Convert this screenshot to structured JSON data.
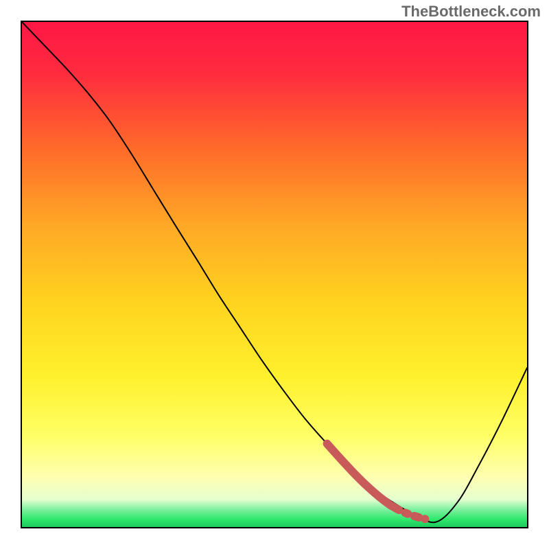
{
  "watermark": "TheBottleneck.com",
  "chart_data": {
    "type": "line",
    "title": "",
    "xlabel": "",
    "ylabel": "",
    "xlim": [
      0,
      100
    ],
    "ylim": [
      0,
      100
    ],
    "grid": false,
    "legend": false,
    "gradient_stops": [
      {
        "offset": 0.0,
        "color": "#ff1744"
      },
      {
        "offset": 0.1,
        "color": "#ff2b3f"
      },
      {
        "offset": 0.25,
        "color": "#ff6a2a"
      },
      {
        "offset": 0.4,
        "color": "#ffa726"
      },
      {
        "offset": 0.55,
        "color": "#ffd21f"
      },
      {
        "offset": 0.7,
        "color": "#fff02c"
      },
      {
        "offset": 0.82,
        "color": "#ffff66"
      },
      {
        "offset": 0.9,
        "color": "#ffffb0"
      },
      {
        "offset": 0.945,
        "color": "#e6ffd0"
      },
      {
        "offset": 0.965,
        "color": "#7ff0a0"
      },
      {
        "offset": 0.985,
        "color": "#2ee86b"
      },
      {
        "offset": 1.0,
        "color": "#1cc95d"
      }
    ],
    "series": [
      {
        "name": "curve",
        "type": "line",
        "color": "#000000",
        "x": [
          0.0,
          4.3,
          8.6,
          13.0,
          17.3,
          21.6,
          25.9,
          30.2,
          34.6,
          38.9,
          43.2,
          47.5,
          51.8,
          56.0,
          60.4,
          64.7,
          69.0,
          73.3,
          77.6,
          82.0,
          86.3,
          90.6,
          95.0,
          100.0
        ],
        "y": [
          100.0,
          95.5,
          91.0,
          86.0,
          80.5,
          74.0,
          67.0,
          60.0,
          53.0,
          46.0,
          39.5,
          33.0,
          27.0,
          21.5,
          16.5,
          12.0,
          8.0,
          5.0,
          2.5,
          1.0,
          5.0,
          12.5,
          21.0,
          31.5
        ]
      },
      {
        "name": "accent-segment",
        "type": "line",
        "color": "#c85a5a",
        "style": "thick-dash-dot",
        "x": [
          60.4,
          63.0,
          65.5,
          67.8,
          69.8,
          71.5,
          73.0,
          75.0,
          77.0,
          78.6
        ],
        "y": [
          16.5,
          13.6,
          10.9,
          8.6,
          6.8,
          5.4,
          4.3,
          3.2,
          2.4,
          1.9
        ]
      }
    ]
  }
}
